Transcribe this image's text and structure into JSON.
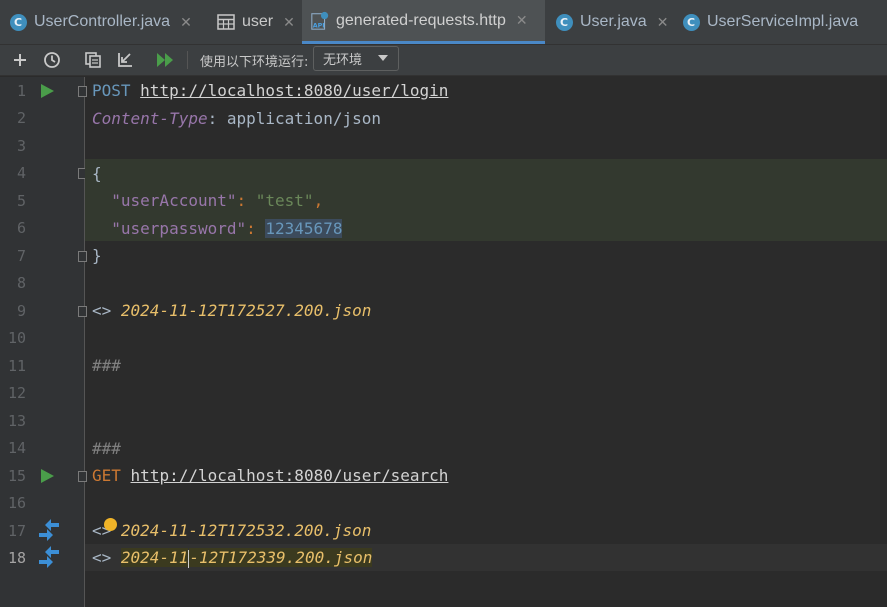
{
  "tabs": [
    {
      "label": "UserController.java",
      "icon": "class-icon",
      "active": false
    },
    {
      "label": "user",
      "icon": "table-icon",
      "active": false
    },
    {
      "label": "generated-requests.http",
      "icon": "api-icon",
      "active": true
    },
    {
      "label": "User.java",
      "icon": "class-icon",
      "active": false
    },
    {
      "label": "UserServiceImpl.java",
      "icon": "class-icon",
      "active": false
    }
  ],
  "toolbar": {
    "env_label": "使用以下环境运行:",
    "env_value": "无环境"
  },
  "line_numbers": [
    "1",
    "2",
    "3",
    "4",
    "5",
    "6",
    "7",
    "8",
    "9",
    "10",
    "11",
    "12",
    "13",
    "14",
    "15",
    "16",
    "17",
    "18"
  ],
  "code": {
    "l1_method": "POST",
    "l1_url": "http://localhost:8080/user/login",
    "l2_header": "Content-Type",
    "l2_sep": ": ",
    "l2_value": "application/json",
    "l4": "{",
    "l5_key": "\"userAccount\"",
    "l5_colon": ": ",
    "l5_val": "\"test\"",
    "l5_comma": ",",
    "l6_key": "\"userpassword\"",
    "l6_colon": ": ",
    "l6_val": "12345678",
    "l7": "}",
    "l9_prefix": "<> ",
    "l9_file": "2024-11-12T172527.200.json",
    "l11": "###",
    "l14": "###",
    "l15_method": "GET",
    "l15_url": "http://localhost:8080/user/search",
    "l17_prefix": "<> ",
    "l17_file": "2024-11-12T172532.200.json",
    "l18_prefix": "<> ",
    "l18_file_a": "2024-11",
    "l18_file_b": "-12T172339.200.json"
  },
  "colors": {
    "background": "#2b2b2b",
    "accent": "#4a88c7",
    "run": "#4a9d4a"
  }
}
